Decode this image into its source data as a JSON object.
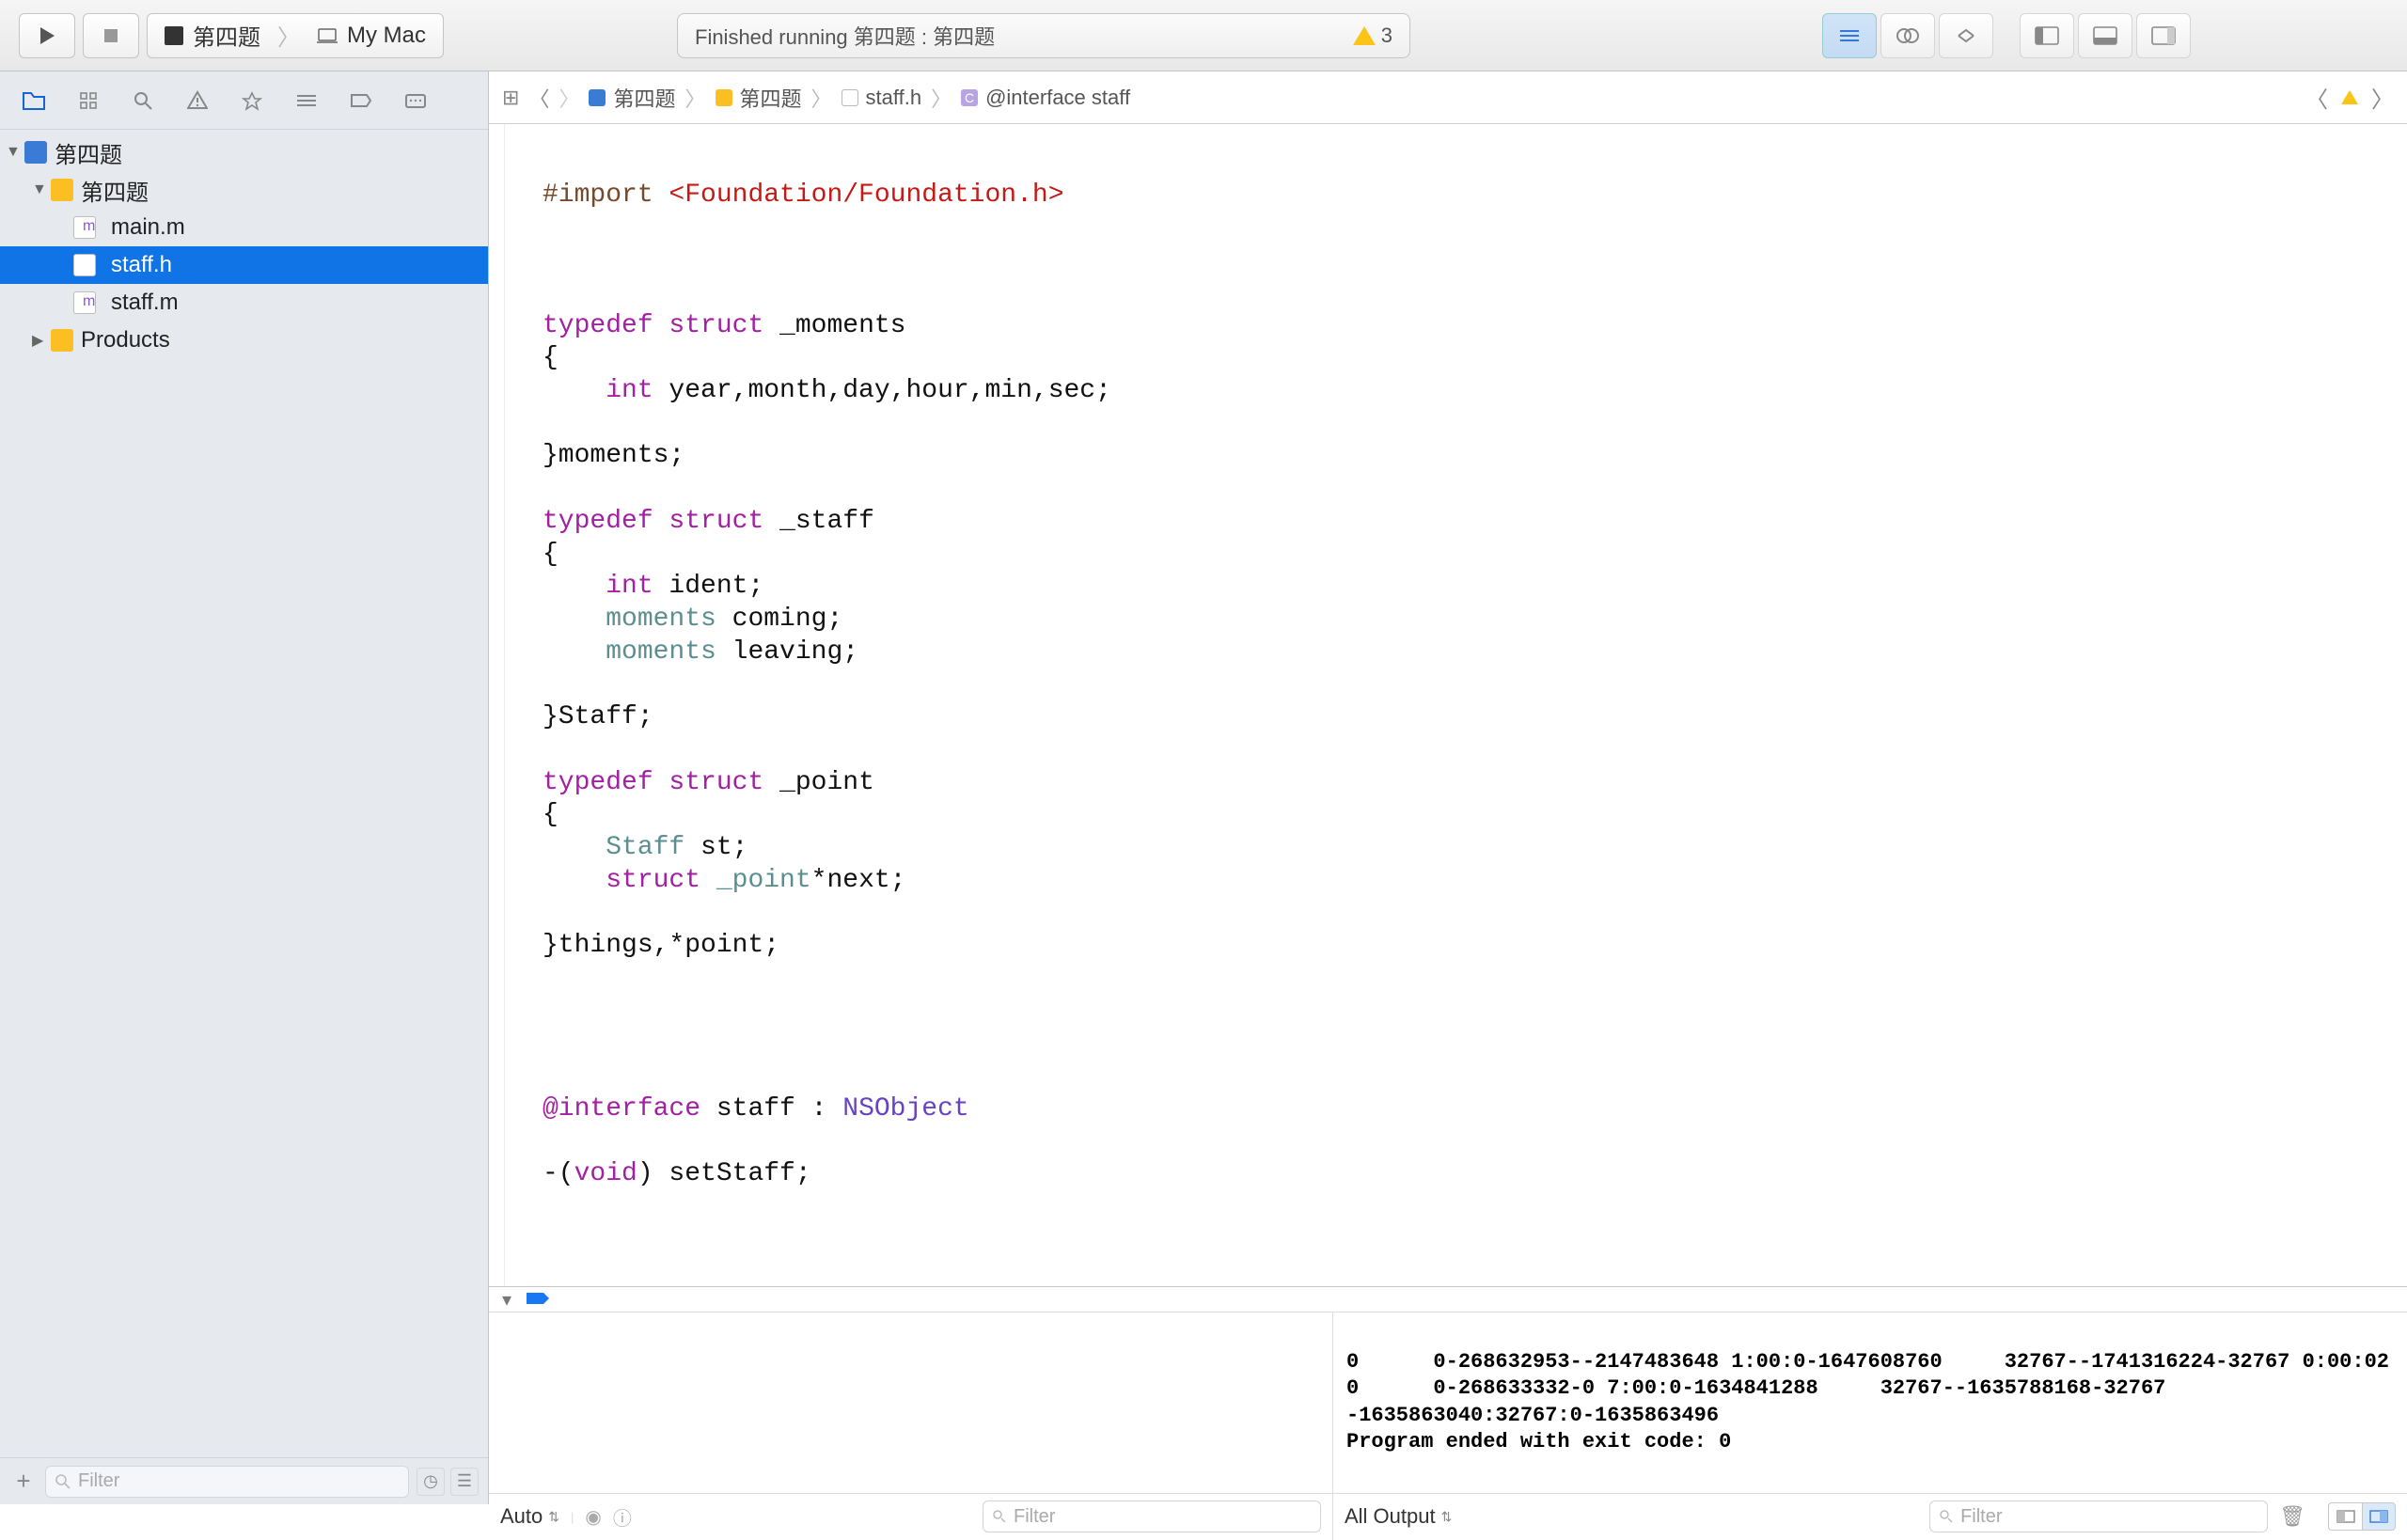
{
  "toolbar": {
    "scheme": {
      "target": "第四题",
      "destination": "My Mac"
    },
    "status": "Finished running 第四题 : 第四题",
    "warnings_count": "3"
  },
  "tree": {
    "root": {
      "name": "第四题"
    },
    "group": {
      "name": "第四题"
    },
    "files": {
      "main": "main.m",
      "staffh": "staff.h",
      "staffm": "staff.m"
    },
    "products": "Products",
    "filter_placeholder": "Filter"
  },
  "jumpbar": {
    "project": "第四题",
    "group": "第四题",
    "file": "staff.h",
    "symbol": "@interface staff"
  },
  "code": {
    "l01a": "#import",
    "l01b": " <Foundation/Foundation.h>",
    "l04a": "typedef",
    "l04b": " struct",
    "l04c": " _moments",
    "l05": "{",
    "l06a": "    int",
    "l06b": " year,month,day,hour,min,sec;",
    "l07": "",
    "l08": "}moments;",
    "l10a": "typedef",
    "l10b": " struct",
    "l10c": " _staff",
    "l11": "{",
    "l12a": "    int",
    "l12b": " ident;",
    "l13a": "    moments",
    "l13b": " coming;",
    "l14a": "    moments",
    "l14b": " leaving;",
    "l15": "",
    "l16": "}Staff;",
    "l18a": "typedef",
    "l18b": " struct",
    "l18c": " _point",
    "l19": "{",
    "l20a": "    Staff",
    "l20b": " st;",
    "l21a": "    struct",
    "l21b": " _point",
    "l21c": "*next;",
    "l22": "",
    "l23": "}things,*point;",
    "l29a": "@interface",
    "l29b": " staff : ",
    "l29c": "NSObject",
    "l31a": "-(",
    "l31b": "void",
    "l31c": ") setStaff;"
  },
  "debug": {
    "variables": {
      "auto_label": "Auto",
      "filter_placeholder": "Filter"
    },
    "console": {
      "line1": "0      0-268632953--2147483648 1:00:0-1647608760     32767--1741316224-32767 0:00:02",
      "line2": "0      0-268633332-0 7:00:0-1634841288     32767--1635788168-32767 -1635863040:32767:0-1635863496",
      "line3": "Program ended with exit code: 0",
      "all_output": "All Output",
      "filter_placeholder": "Filter"
    }
  }
}
